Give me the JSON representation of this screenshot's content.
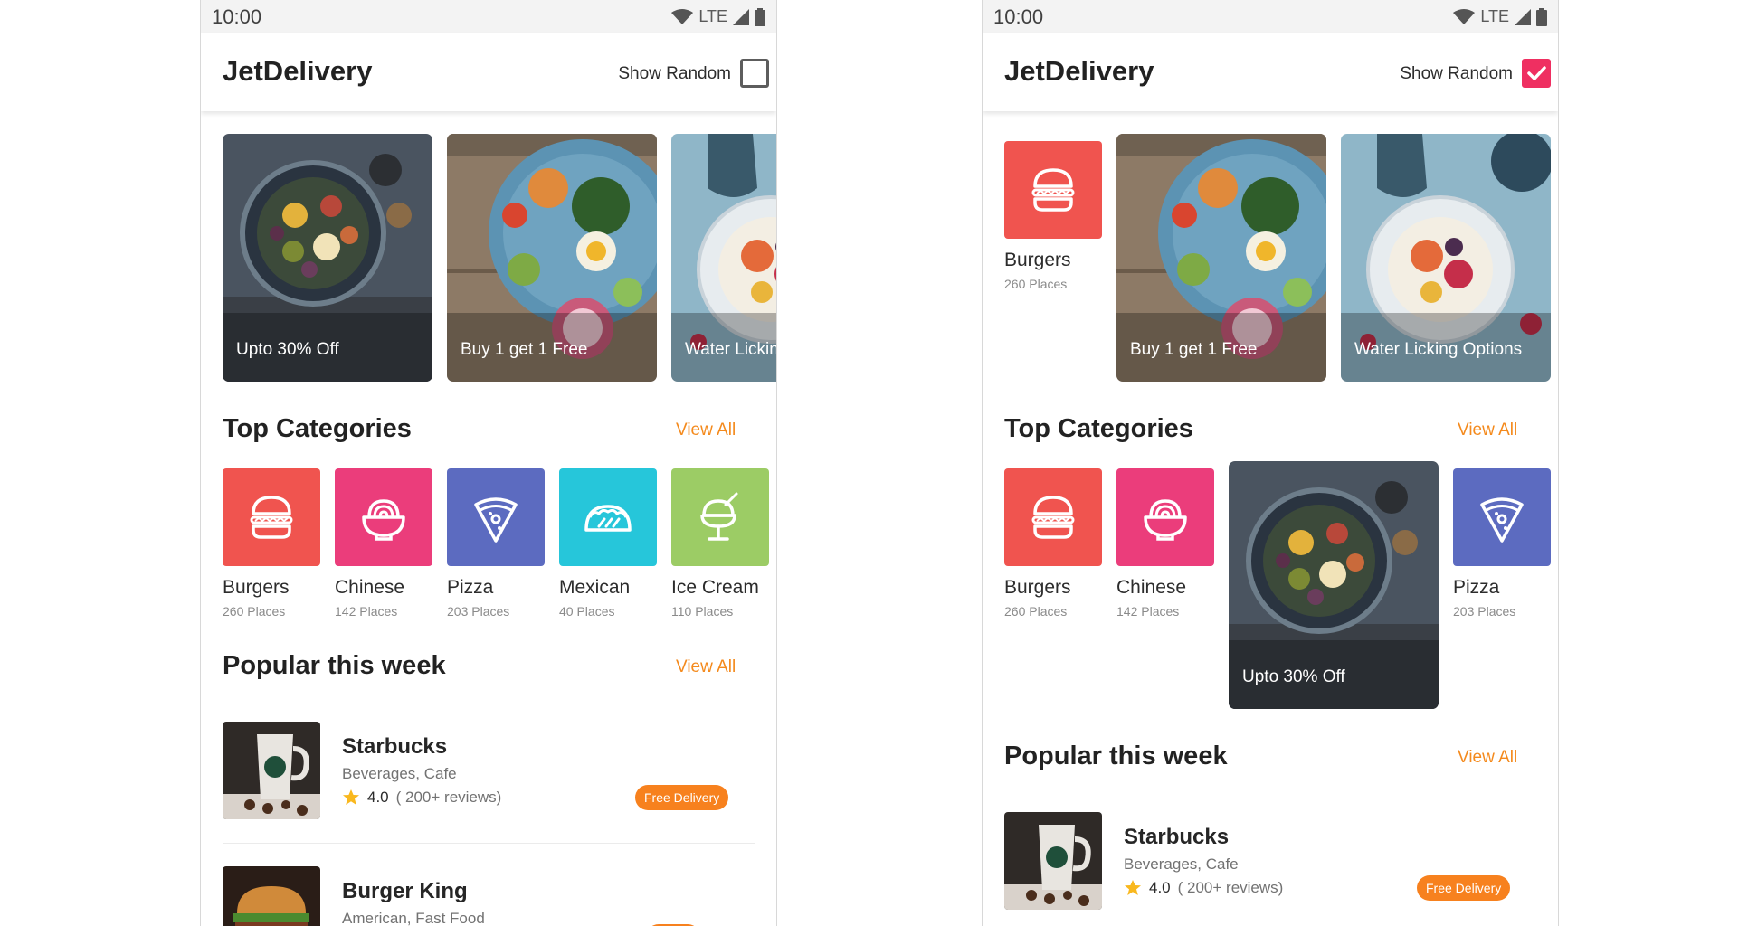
{
  "status": {
    "time": "10:00",
    "network": "LTE"
  },
  "app": {
    "title": "JetDelivery",
    "show_random_label": "Show Random"
  },
  "offers": [
    {
      "caption": "Upto 30% Off"
    },
    {
      "caption": "Buy 1 get 1 Free"
    },
    {
      "caption": "Water Licking Options"
    }
  ],
  "sections": {
    "top_categories": "Top Categories",
    "popular": "Popular this week",
    "view_all": "View All"
  },
  "categories": [
    {
      "name": "Burgers",
      "count": "260 Places",
      "color": "#f0544f",
      "icon": "burger-icon"
    },
    {
      "name": "Chinese",
      "count": "142 Places",
      "color": "#eb3d7b",
      "icon": "noodle-bowl-icon"
    },
    {
      "name": "Pizza",
      "count": "203 Places",
      "color": "#5c6bc0",
      "icon": "pizza-slice-icon"
    },
    {
      "name": "Mexican",
      "count": "40 Places",
      "color": "#26c6da",
      "icon": "taco-icon"
    },
    {
      "name": "Ice Cream",
      "count": "110 Places",
      "color": "#9ccc65",
      "icon": "ice-cream-icon"
    }
  ],
  "places": [
    {
      "name": "Starbucks",
      "tags": "Beverages, Cafe",
      "rating": "4.0",
      "reviews": "( 200+ reviews)",
      "badge": "Free Delivery"
    },
    {
      "name": "Burger King",
      "tags": "American, Fast Food"
    }
  ],
  "colors": {
    "accent": "#f48a1d",
    "checkbox_checked": "#ef2f61",
    "star": "#f9b81e"
  },
  "screens": [
    {
      "show_random_checked": false
    },
    {
      "show_random_checked": true
    }
  ]
}
